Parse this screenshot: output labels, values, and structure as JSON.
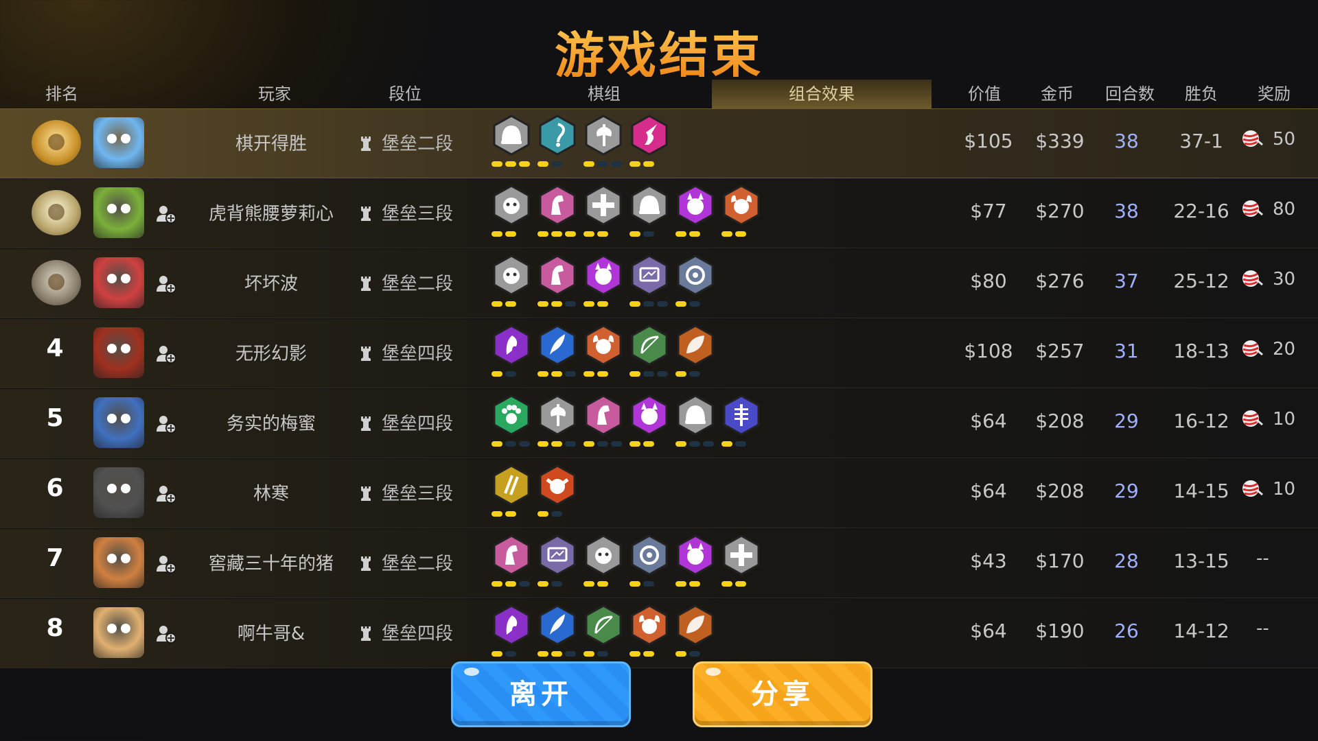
{
  "title": "游戏结束",
  "headers": {
    "rank": "排名",
    "player": "玩家",
    "tier": "段位",
    "deck": "棋组",
    "synergy": "组合效果",
    "value": "价值",
    "gold": "金币",
    "rounds": "回合数",
    "winloss": "胜负",
    "reward": "奖励"
  },
  "colors": {
    "accent_gold": "#f5a623",
    "round_text": "#9fb0ff",
    "bar_on": "#f7d21a",
    "bar_off": "#1e3244",
    "leave_button": "#2a8ff4",
    "share_button": "#f6a51b"
  },
  "players": [
    {
      "rank": "1",
      "medal": "gold-medal",
      "avatar_color": "#6fb6f0",
      "name": "棋开得胜",
      "tier": "堡垒二段",
      "value": "$105",
      "gold": "$339",
      "rounds": "38",
      "winloss": "37-1",
      "reward": "50",
      "has_add_friend": false,
      "synergies": [
        {
          "icon": "helmet-icon",
          "color": "#9a9a9a"
        },
        {
          "icon": "hook-icon",
          "color": "#3a9aa8"
        },
        {
          "icon": "axe-icon",
          "color": "#9a9a9a"
        },
        {
          "icon": "flame-icon",
          "color": "#d62c8c"
        }
      ],
      "bars": [
        [
          1,
          1,
          1
        ],
        [
          1,
          0
        ],
        [
          1,
          0,
          0
        ],
        [
          1,
          1
        ]
      ]
    },
    {
      "rank": "2",
      "medal": "silver-medal",
      "avatar_color": "#7bb03a",
      "name": "虎背熊腰萝莉心",
      "tier": "堡垒三段",
      "value": "$77",
      "gold": "$270",
      "rounds": "38",
      "winloss": "22-16",
      "reward": "80",
      "has_add_friend": true,
      "synergies": [
        {
          "icon": "beast-icon",
          "color": "#9a9a9a"
        },
        {
          "icon": "knight-icon",
          "color": "#c85a9e"
        },
        {
          "icon": "cross-icon",
          "color": "#9a9a9a"
        },
        {
          "icon": "helmet-icon",
          "color": "#9a9a9a"
        },
        {
          "icon": "demon-icon",
          "color": "#b036d8"
        },
        {
          "icon": "viking-icon",
          "color": "#d06030"
        }
      ],
      "bars": [
        [
          1,
          1
        ],
        [
          1,
          1,
          1
        ],
        [
          1,
          1
        ],
        [
          1,
          0
        ],
        [
          1,
          1
        ],
        [
          1,
          1
        ]
      ]
    },
    {
      "rank": "3",
      "medal": "bronze-medal",
      "avatar_color": "#d04040",
      "name": "坏坏波",
      "tier": "堡垒二段",
      "value": "$80",
      "gold": "$276",
      "rounds": "37",
      "winloss": "25-12",
      "reward": "30",
      "has_add_friend": true,
      "synergies": [
        {
          "icon": "beast-icon",
          "color": "#9a9a9a"
        },
        {
          "icon": "knight-icon",
          "color": "#c85a9e"
        },
        {
          "icon": "demon-icon",
          "color": "#b036d8"
        },
        {
          "icon": "mech-icon",
          "color": "#7a6aa8"
        },
        {
          "icon": "dragon-icon",
          "color": "#6a7a9a"
        }
      ],
      "bars": [
        [
          1,
          1
        ],
        [
          1,
          1,
          0
        ],
        [
          1,
          1
        ],
        [
          1,
          0,
          0
        ],
        [
          1,
          0
        ]
      ]
    },
    {
      "rank": "4",
      "medal": "",
      "avatar_color": "#a03020",
      "name": "无形幻影",
      "tier": "堡垒四段",
      "value": "$108",
      "gold": "$257",
      "rounds": "31",
      "winloss": "18-13",
      "reward": "20",
      "has_add_friend": true,
      "synergies": [
        {
          "icon": "mage-icon",
          "color": "#8a30c8"
        },
        {
          "icon": "feather-icon",
          "color": "#2a6ad0"
        },
        {
          "icon": "viking-icon",
          "color": "#d06030"
        },
        {
          "icon": "bow-icon",
          "color": "#4a8a4a"
        },
        {
          "icon": "leaf-icon",
          "color": "#c06020"
        }
      ],
      "bars": [
        [
          1,
          0
        ],
        [
          1,
          1,
          0
        ],
        [
          1,
          1
        ],
        [
          1,
          0,
          0
        ],
        [
          1,
          0
        ]
      ]
    },
    {
      "rank": "5",
      "medal": "",
      "avatar_color": "#4070c0",
      "name": "务实的梅蜜",
      "tier": "堡垒四段",
      "value": "$64",
      "gold": "$208",
      "rounds": "29",
      "winloss": "16-12",
      "reward": "10",
      "has_add_friend": true,
      "synergies": [
        {
          "icon": "paw-icon",
          "color": "#2aa860"
        },
        {
          "icon": "axe-icon",
          "color": "#9a9a9a"
        },
        {
          "icon": "knight-icon",
          "color": "#c85a9e"
        },
        {
          "icon": "demon-icon",
          "color": "#b036d8"
        },
        {
          "icon": "helmet-icon",
          "color": "#9a9a9a"
        },
        {
          "icon": "skeleton-icon",
          "color": "#4a4ac8"
        }
      ],
      "bars": [
        [
          1,
          0,
          0
        ],
        [
          1,
          1,
          0
        ],
        [
          1,
          0,
          0
        ],
        [
          1,
          1
        ],
        [
          1,
          0,
          0
        ],
        [
          1,
          0
        ]
      ]
    },
    {
      "rank": "6",
      "medal": "",
      "avatar_color": "#505050",
      "name": "林寒",
      "tier": "堡垒三段",
      "value": "$64",
      "gold": "$208",
      "rounds": "29",
      "winloss": "14-15",
      "reward": "10",
      "has_add_friend": true,
      "synergies": [
        {
          "icon": "claw-icon",
          "color": "#c8a020"
        },
        {
          "icon": "goblin-icon",
          "color": "#d04a20"
        }
      ],
      "bars": [
        [
          1,
          1
        ],
        [
          1,
          0
        ]
      ]
    },
    {
      "rank": "7",
      "medal": "",
      "avatar_color": "#d08040",
      "name": "窖藏三十年的猪",
      "tier": "堡垒二段",
      "value": "$43",
      "gold": "$170",
      "rounds": "28",
      "winloss": "13-15",
      "reward": "--",
      "has_add_friend": true,
      "synergies": [
        {
          "icon": "knight-icon",
          "color": "#c85a9e"
        },
        {
          "icon": "mech-icon",
          "color": "#7a6aa8"
        },
        {
          "icon": "beast-icon",
          "color": "#9a9a9a"
        },
        {
          "icon": "dragon-icon",
          "color": "#6a7a9a"
        },
        {
          "icon": "demon-icon",
          "color": "#b036d8"
        },
        {
          "icon": "cross-icon",
          "color": "#9a9a9a"
        }
      ],
      "bars": [
        [
          1,
          1,
          0
        ],
        [
          1,
          0
        ],
        [
          1,
          1
        ],
        [
          1,
          0
        ],
        [
          1,
          1
        ],
        [
          1,
          1
        ]
      ]
    },
    {
      "rank": "8",
      "medal": "",
      "avatar_color": "#e0b070",
      "name": "啊牛哥&",
      "tier": "堡垒四段",
      "value": "$64",
      "gold": "$190",
      "rounds": "26",
      "winloss": "14-12",
      "reward": "--",
      "has_add_friend": true,
      "synergies": [
        {
          "icon": "mage-icon",
          "color": "#8a30c8"
        },
        {
          "icon": "feather-icon",
          "color": "#2a6ad0"
        },
        {
          "icon": "bow-icon",
          "color": "#4a8a4a"
        },
        {
          "icon": "viking-icon",
          "color": "#d06030"
        },
        {
          "icon": "leaf-icon",
          "color": "#c06020"
        }
      ],
      "bars": [
        [
          1,
          0
        ],
        [
          1,
          1,
          0
        ],
        [
          1,
          0
        ],
        [
          1,
          1
        ],
        [
          1,
          0
        ]
      ]
    }
  ],
  "buttons": {
    "leave": "离开",
    "share": "分享"
  }
}
